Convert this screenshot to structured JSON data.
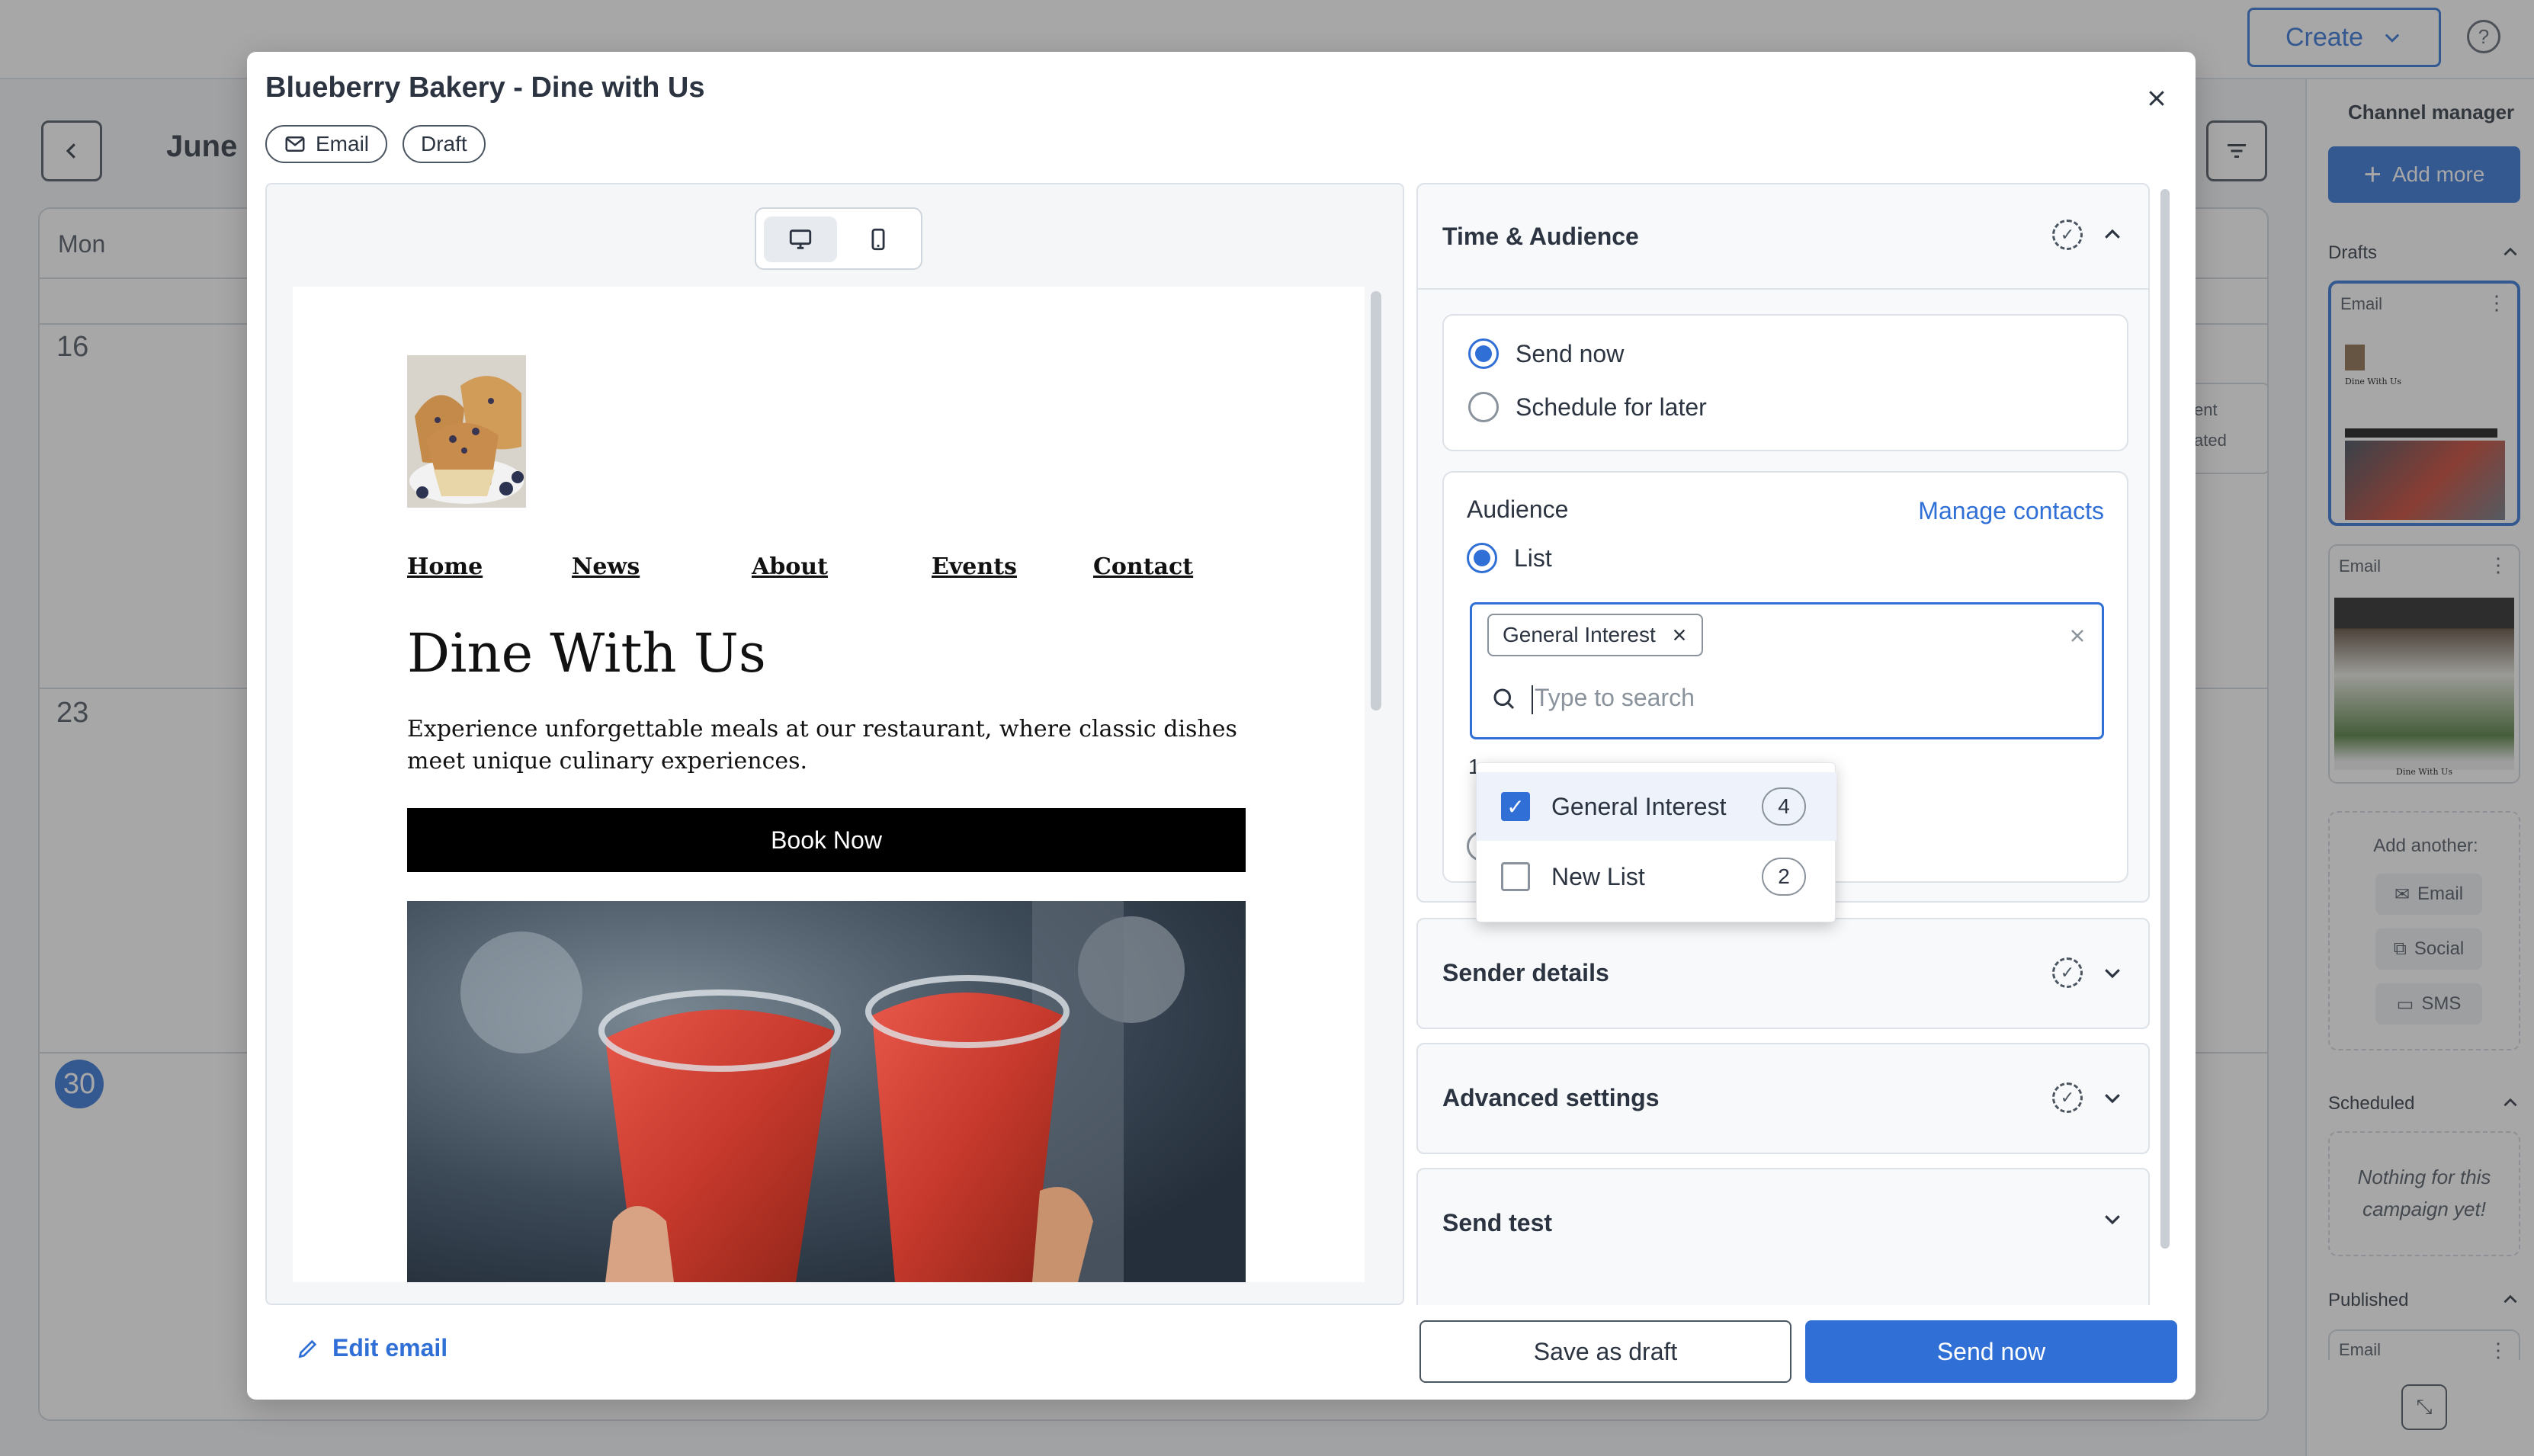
{
  "background": {
    "create_label": "Create",
    "help_icon": "question-circle-icon",
    "month_title": "June",
    "weekday_header": "Mon",
    "week_numbers": [
      "16",
      "23",
      "30"
    ],
    "channel_manager_title": "Channel manager",
    "add_more_label": "Add more",
    "drafts_label": "Drafts",
    "draft_cards": [
      {
        "label": "Email",
        "email_title": "Dine With Us"
      },
      {
        "label": "Email",
        "email_title": "Dine With Us"
      }
    ],
    "add_another_label": "Add another:",
    "add_another_options": [
      "Email",
      "Social",
      "SMS"
    ],
    "scheduled_label": "Scheduled",
    "scheduled_empty_text": "Nothing for this campaign yet!",
    "published_label": "Published",
    "published_card_label": "Email",
    "peek_texts": [
      "ent",
      "ated"
    ]
  },
  "modal": {
    "title": "Blueberry Bakery - Dine with Us",
    "pills": [
      {
        "icon": "envelope-icon",
        "label": "Email"
      },
      {
        "label": "Draft"
      }
    ],
    "preview": {
      "device_options": [
        "desktop-icon",
        "mobile-icon"
      ],
      "active_device": "desktop",
      "email": {
        "nav_links": [
          "Home",
          "News",
          "About",
          "Events",
          "Contact"
        ],
        "heading": "Dine With Us",
        "body": "Experience unforgettable meals at our restaurant, where classic dishes meet unique culinary experiences.",
        "cta_label": "Book Now"
      }
    },
    "settings": {
      "time_audience": {
        "title": "Time & Audience",
        "send_options": [
          {
            "label": "Send now",
            "selected": true
          },
          {
            "label": "Schedule for later",
            "selected": false
          }
        ],
        "audience_label": "Audience",
        "manage_contacts_label": "Manage contacts",
        "audience_type": {
          "label": "List",
          "selected": true
        },
        "selected_tags": [
          "General Interest"
        ],
        "search_placeholder": "Type to search",
        "hidden_char": "1",
        "dropdown_options": [
          {
            "label": "General Interest",
            "count": "4",
            "checked": true
          },
          {
            "label": "New List",
            "count": "2",
            "checked": false
          }
        ]
      },
      "sender_details_title": "Sender details",
      "advanced_settings_title": "Advanced settings",
      "send_test_title": "Send test"
    },
    "footer": {
      "edit_email_label": "Edit email",
      "save_draft_label": "Save as draft",
      "send_now_label": "Send now"
    }
  },
  "colors": {
    "accent": "#2f6fd6",
    "text": "#2b3440",
    "overlay": "rgba(60,60,60,0.45)"
  }
}
